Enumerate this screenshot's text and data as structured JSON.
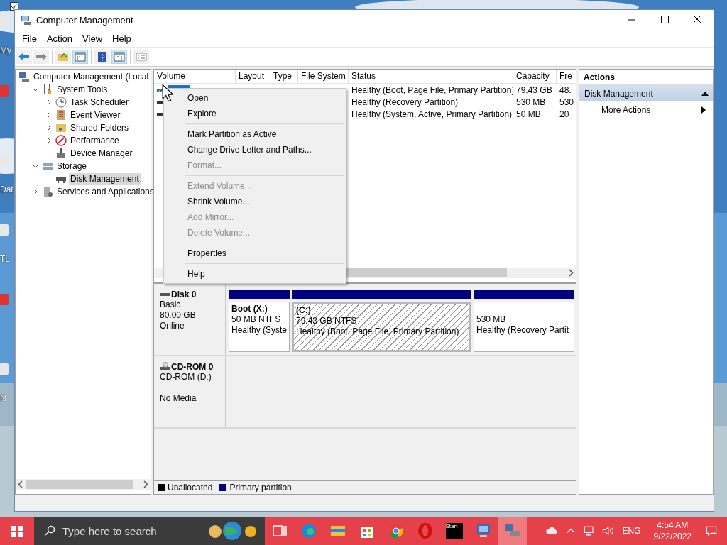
{
  "desktop_icons": [
    {
      "label": "My"
    },
    {
      "kind": "app"
    },
    {
      "label": "Dat"
    },
    {
      "label": "TL"
    },
    {
      "kind": "app"
    },
    {
      "label": "N"
    }
  ],
  "window": {
    "title": "Computer Management"
  },
  "menu": [
    "File",
    "Action",
    "View",
    "Help"
  ],
  "toolbar": [
    {
      "kind": "back",
      "pressed": false
    },
    {
      "kind": "forward",
      "pressed": false
    },
    {
      "kind": "separator"
    },
    {
      "kind": "up",
      "pressed": false
    },
    {
      "kind": "tree",
      "pressed": true
    },
    {
      "kind": "separator"
    },
    {
      "kind": "help",
      "pressed": false
    },
    {
      "kind": "pane",
      "pressed": true
    },
    {
      "kind": "separator"
    },
    {
      "kind": "list",
      "pressed": false
    }
  ],
  "tree": [
    {
      "label": "Computer Management (Local",
      "kind": "computer",
      "selected": false,
      "children": [
        {
          "label": "System Tools",
          "kind": "tools",
          "expanded": true,
          "selected": false,
          "children": [
            {
              "label": "Task Scheduler",
              "kind": "clock",
              "expanded": false,
              "selected": false
            },
            {
              "label": "Event Viewer",
              "kind": "log",
              "expanded": false,
              "selected": false
            },
            {
              "label": "Shared Folders",
              "kind": "folder",
              "expanded": false,
              "selected": false
            },
            {
              "label": "Performance",
              "kind": "performance",
              "expanded": false,
              "selected": false
            },
            {
              "label": "Device Manager",
              "kind": "device",
              "selected": false
            }
          ]
        },
        {
          "label": "Storage",
          "kind": "storage",
          "expanded": true,
          "selected": false,
          "children": [
            {
              "label": "Disk Management",
              "kind": "disk",
              "selected": true
            }
          ]
        },
        {
          "label": "Services and Applications",
          "kind": "services",
          "expanded": false,
          "selected": false
        }
      ]
    }
  ],
  "volume_table": {
    "columns": [
      "Volume",
      "Layout",
      "Type",
      "File System",
      "Status",
      "Capacity",
      "Fre"
    ],
    "rows": [
      {
        "selected": true,
        "status": "Healthy (Boot, Page File, Primary Partition)",
        "capacity": "79.43 GB",
        "column_7": "48."
      },
      {
        "selected": false,
        "status": "Healthy (Recovery Partition)",
        "capacity": "530 MB",
        "column_7": "530"
      },
      {
        "selected": false,
        "status": "Healthy (System, Active, Primary Partition)",
        "capacity": "50 MB",
        "column_7": "20"
      }
    ]
  },
  "context_menu": [
    {
      "kind": "item",
      "label": "Open",
      "disabled": false
    },
    {
      "kind": "item",
      "label": "Explore",
      "disabled": false
    },
    {
      "kind": "separator"
    },
    {
      "kind": "item",
      "label": "Mark Partition as Active",
      "disabled": false
    },
    {
      "kind": "item",
      "label": "Change Drive Letter and Paths...",
      "disabled": false
    },
    {
      "kind": "item",
      "label": "Format...",
      "disabled": true
    },
    {
      "kind": "separator"
    },
    {
      "kind": "item",
      "label": "Extend Volume...",
      "disabled": true
    },
    {
      "kind": "item",
      "label": "Shrink Volume...",
      "disabled": false
    },
    {
      "kind": "item",
      "label": "Add Mirror...",
      "disabled": true
    },
    {
      "kind": "item",
      "label": "Delete Volume...",
      "disabled": true
    },
    {
      "kind": "separator"
    },
    {
      "kind": "item",
      "label": "Properties",
      "disabled": false
    },
    {
      "kind": "separator"
    },
    {
      "kind": "item",
      "label": "Help",
      "disabled": false
    }
  ],
  "disks": [
    {
      "kind": "disk",
      "name": "Disk 0",
      "info": [
        "Basic",
        "80.00 GB",
        "Online"
      ],
      "partitions": [
        {
          "title": "Boot  (X:)",
          "size": "50 MB NTFS",
          "status": "Healthy (Syste",
          "selected": false
        },
        {
          "title": "(C:)",
          "size": "79.43 GB NTFS",
          "status": "Healthy (Boot, Page File, Primary Partition)",
          "selected": true
        },
        {
          "size": "530 MB",
          "status": "Healthy (Recovery Partit",
          "selected": false
        }
      ]
    },
    {
      "kind": "cdrom",
      "name": "CD-ROM 0",
      "info": [
        "CD-ROM (D:)"
      ],
      "note": "No Media"
    }
  ],
  "legend": [
    {
      "label": "Unallocated",
      "color": "#000000"
    },
    {
      "label": "Primary partition",
      "color": "#000080"
    }
  ],
  "actions": {
    "header": "Actions",
    "sections": [
      {
        "title": "Disk Management",
        "expanded": true,
        "items": [
          "More Actions"
        ]
      }
    ]
  },
  "taskbar": {
    "search_placeholder": "Type here to search",
    "apps": [
      {
        "kind": "taskview",
        "selected": false
      },
      {
        "kind": "edge",
        "selected": false
      },
      {
        "kind": "explorer",
        "selected": false
      },
      {
        "kind": "store",
        "selected": false
      },
      {
        "kind": "chrome",
        "selected": false
      },
      {
        "kind": "opera",
        "selected": false
      },
      {
        "kind": "terminal",
        "label": "Start",
        "selected": false
      },
      {
        "kind": "remote",
        "selected": false
      },
      {
        "kind": "manage",
        "selected": true
      }
    ],
    "tray": [
      {
        "kind": "cloud"
      },
      {
        "kind": "chevron"
      },
      {
        "kind": "network"
      },
      {
        "kind": "volume"
      }
    ],
    "language": "ENG",
    "time": "4:54 AM",
    "date": "9/22/2022"
  }
}
